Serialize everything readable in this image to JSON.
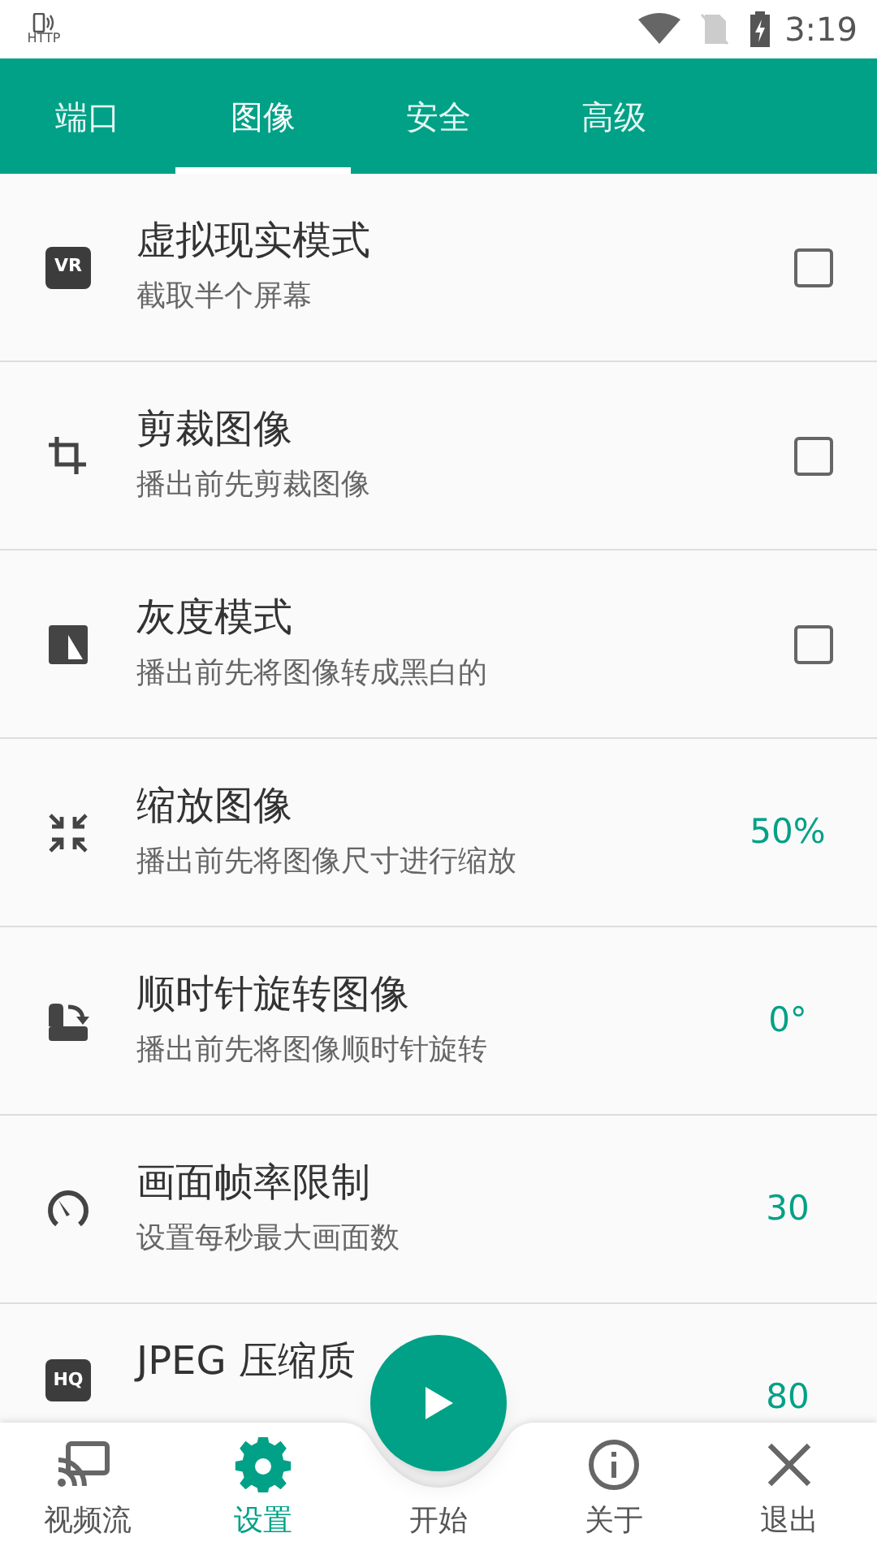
{
  "status_bar": {
    "notification": "HTTP",
    "time": "3:19"
  },
  "tabs": [
    {
      "label": "端口",
      "selected": false
    },
    {
      "label": "图像",
      "selected": true
    },
    {
      "label": "安全",
      "selected": false
    },
    {
      "label": "高级",
      "selected": false
    }
  ],
  "settings": [
    {
      "badge": "VR",
      "title": "虚拟现实模式",
      "subtitle": "截取半个屏幕",
      "kind": "checkbox",
      "checked": false
    },
    {
      "title": "剪裁图像",
      "subtitle": "播出前先剪裁图像",
      "kind": "checkbox",
      "checked": false
    },
    {
      "title": "灰度模式",
      "subtitle": "播出前先将图像转成黑白的",
      "kind": "checkbox",
      "checked": false
    },
    {
      "title": "缩放图像",
      "subtitle": "播出前先将图像尺寸进行缩放",
      "kind": "value",
      "value": "50%"
    },
    {
      "title": "顺时针旋转图像",
      "subtitle": "播出前先将图像顺时针旋转",
      "kind": "value",
      "value": "0°"
    },
    {
      "title": "画面帧率限制",
      "subtitle": "设置每秒最大画面数",
      "kind": "value",
      "value": "30"
    },
    {
      "badge": "HQ",
      "title": "JPEG 压缩质",
      "kind": "value",
      "value": "80"
    }
  ],
  "bottom_nav": [
    {
      "label": "视频流",
      "selected": false
    },
    {
      "label": "设置",
      "selected": true
    },
    {
      "label": "开始",
      "selected": false
    },
    {
      "label": "关于",
      "selected": false
    },
    {
      "label": "退出",
      "selected": false
    }
  ]
}
